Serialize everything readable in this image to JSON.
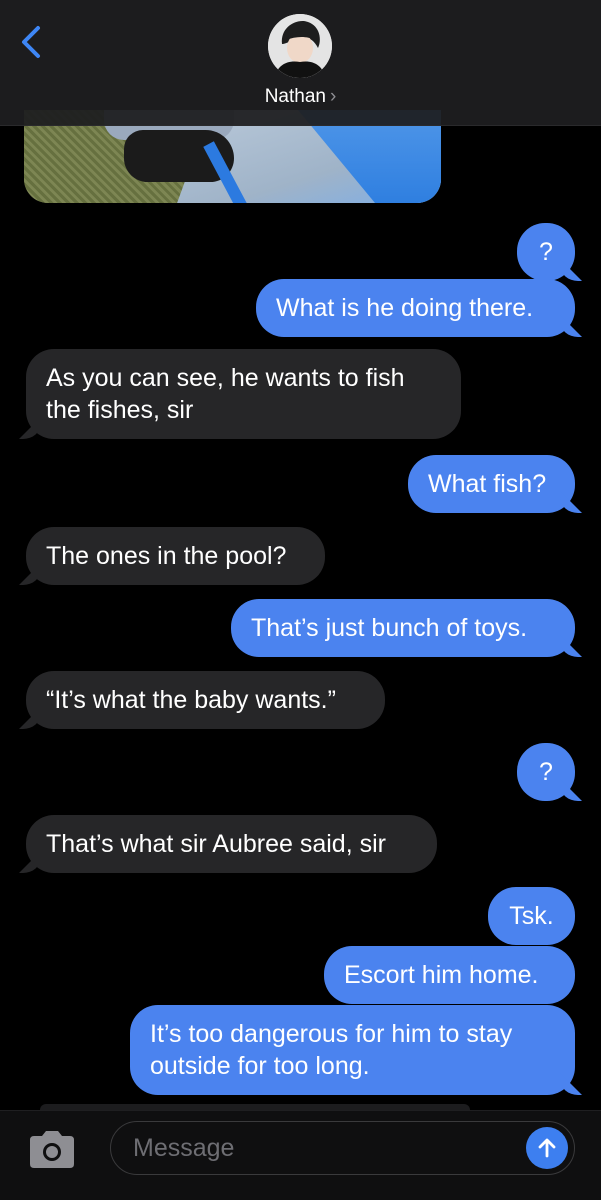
{
  "header": {
    "contact_name": "Nathan",
    "chevron": "›",
    "back_icon": "chevron-left-icon"
  },
  "messages": [
    {
      "dir": "out",
      "text": "?"
    },
    {
      "dir": "out",
      "text": "What is he doing there."
    },
    {
      "dir": "in",
      "text": "As you can see, he wants to fish the fishes, sir"
    },
    {
      "dir": "out",
      "text": "What fish?"
    },
    {
      "dir": "in",
      "text": "The ones in the pool?"
    },
    {
      "dir": "out",
      "text": "That’s just bunch of toys."
    },
    {
      "dir": "in",
      "text": "“It’s what the baby wants.”"
    },
    {
      "dir": "out",
      "text": "?"
    },
    {
      "dir": "in",
      "text": "That’s what sir Aubree said, sir"
    },
    {
      "dir": "out",
      "text": "Tsk."
    },
    {
      "dir": "out",
      "text": "Escort him home."
    },
    {
      "dir": "out",
      "text": "It’s too dangerous for him to stay outside for too long."
    }
  ],
  "input": {
    "placeholder": "Message",
    "camera_icon": "camera-icon",
    "send_icon": "arrow-up-icon"
  },
  "colors": {
    "outgoing_bubble": "#4b83ef",
    "incoming_bubble": "#262628",
    "background": "#000000"
  }
}
